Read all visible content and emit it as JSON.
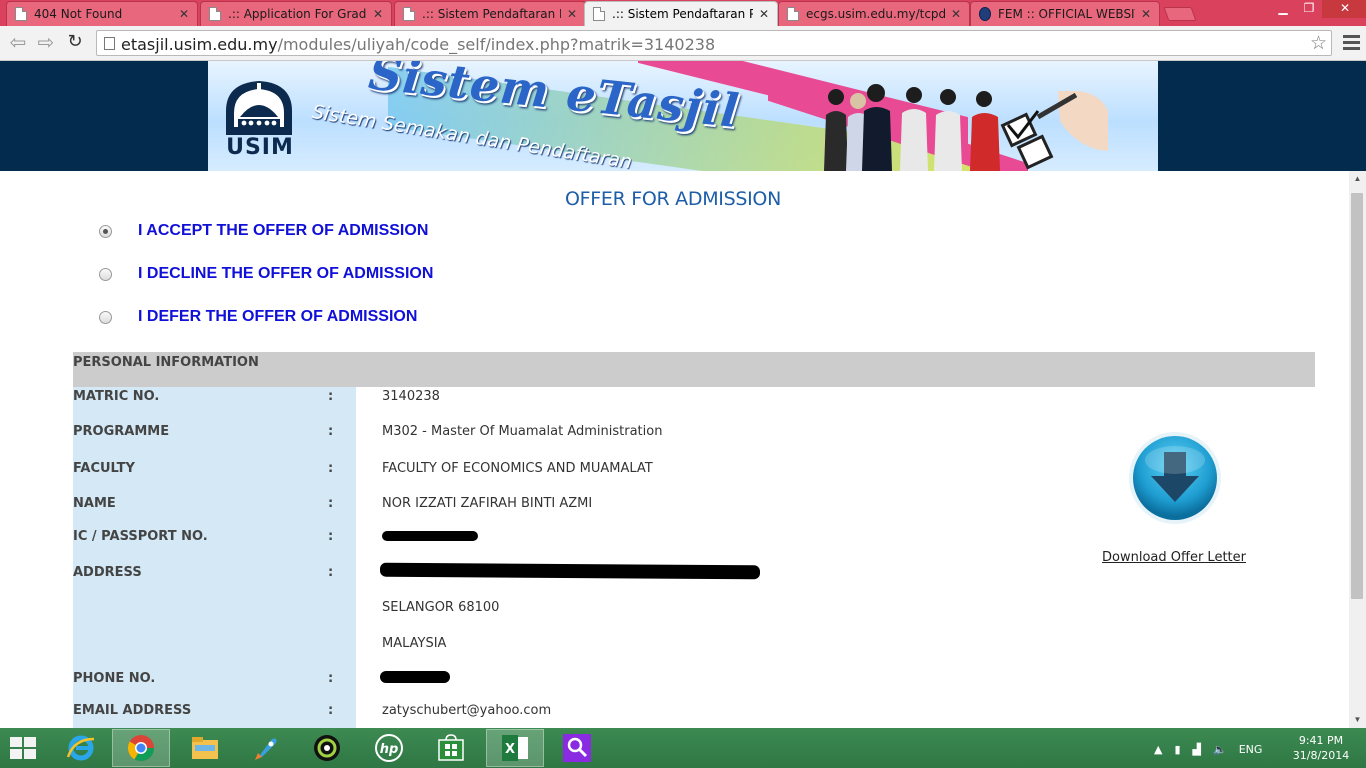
{
  "browser": {
    "tabs": [
      {
        "title": "404 Not Found",
        "icon": "page-icon",
        "active": false
      },
      {
        "title": ".:: Application For Graduat",
        "icon": "page-icon",
        "active": false
      },
      {
        "title": ".:: Sistem Pendaftaran Pela",
        "icon": "page-icon",
        "active": false
      },
      {
        "title": ".:: Sistem Pendaftaran Pela",
        "icon": "page-icon",
        "active": true
      },
      {
        "title": "ecgs.usim.edu.my/tcpdf/:",
        "icon": "page-icon",
        "active": false
      },
      {
        "title": "FEM :: OFFICIAL WEBSITE",
        "icon": "site-logo-icon",
        "active": false
      }
    ],
    "url_host": "etasjil.usim.edu.my",
    "url_path": "/modules/uliyah/code_self/index.php?matrik=3140238"
  },
  "banner": {
    "logo_text": "USIM",
    "title": "Sistem eTasjil",
    "subtitle": "Sistem Semakan dan Pendaftaran"
  },
  "page": {
    "heading": "OFFER FOR ADMISSION",
    "options": [
      {
        "label": "I ACCEPT THE OFFER OF ADMISSION",
        "selected": true
      },
      {
        "label": "I DECLINE THE OFFER OF ADMISSION",
        "selected": false
      },
      {
        "label": "I DEFER THE OFFER OF ADMISSION",
        "selected": false
      }
    ],
    "section_title": "PERSONAL INFORMATION",
    "separator": ":",
    "fields": {
      "matric_label": "MATRIC NO.",
      "matric_value": "3140238",
      "programme_label": "PROGRAMME",
      "programme_value": "M302 - Master Of Muamalat Administration",
      "faculty_label": "FACULTY",
      "faculty_value": "FACULTY OF ECONOMICS AND MUAMALAT",
      "name_label": "NAME",
      "name_value": "NOR IZZATI ZAFIRAH BINTI AZMI",
      "ic_label": "IC / PASSPORT NO.",
      "address_label": "ADDRESS",
      "address_line2": "SELANGOR 68100",
      "address_line3": "MALAYSIA",
      "phone_label": "PHONE NO.",
      "email_label": "EMAIL ADDRESS",
      "email_value": "zatyschubert@yahoo.com"
    },
    "download_label": "Download Offer Letter"
  },
  "taskbar": {
    "language": "ENG",
    "time": "9:41 PM",
    "date": "31/8/2014"
  },
  "colors": {
    "tabstrip": "#d9415c",
    "banner_bg": "#032b4e",
    "heading": "#1e5ea8",
    "option_text": "#1010d8",
    "section_header": "#cccccc",
    "label_column": "#d4e8f5",
    "taskbar": "#2f7744"
  }
}
